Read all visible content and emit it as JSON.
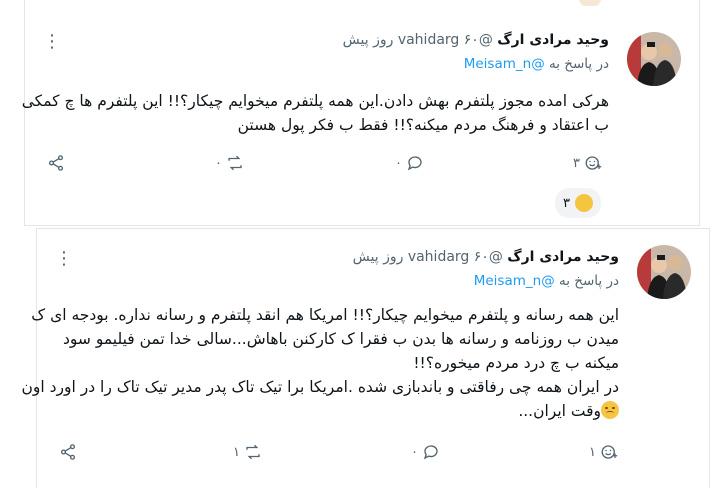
{
  "colors": {
    "accent": "#1d9bf0",
    "muted": "#536471",
    "text": "#0f1419",
    "border": "#e3e6ea"
  },
  "tweets": [
    {
      "name": "وحید مرادی ارگ",
      "handle": "@vahidarg",
      "time": "۶۰ روز پیش",
      "reply_prefix": "در پاسخ به",
      "reply_to": "@Meisam_n",
      "lines": [
        "هرکی امده مجوز پلتفرم بهش دادن.این همه پلتفرم میخوایم چیکار؟!! این پلتفرم ها چ کمکی",
        "ب اعتقاد و فرهنگ مردم میکنه؟!! فقط ب فکر پول هستن"
      ],
      "likes": "۳",
      "replies": "۰",
      "retweets": "۰",
      "reaction_count": "۳",
      "reaction_icon": "thumbs-up-icon"
    },
    {
      "name": "وحید مرادی ارگ",
      "handle": "@vahidarg",
      "time": "۶۰ روز پیش",
      "reply_prefix": "در پاسخ به",
      "reply_to": "@Meisam_n",
      "lines": [
        "این همه رسانه و پلتفرم میخوایم چیکار؟!! امریکا هم انقد پلتفرم و رسانه نداره. بودجه ای ک",
        "میدن ب روزنامه و رسانه ها بدن ب فقرا ک کارکنن باهاش...سالی خدا تمن فیلیمو سود",
        "میکنه ب چ درد مردم میخوره؟!!",
        "در ایران همه چی رفاقتی و باندبازی شده .امریکا برا تیک تاک پدر مدیر تیک تاک را در اورد اون",
        "وقت ایران..."
      ],
      "likes": "۱",
      "replies": "۰",
      "retweets": "۱",
      "emoji_icon": "sad-face-icon"
    }
  ]
}
